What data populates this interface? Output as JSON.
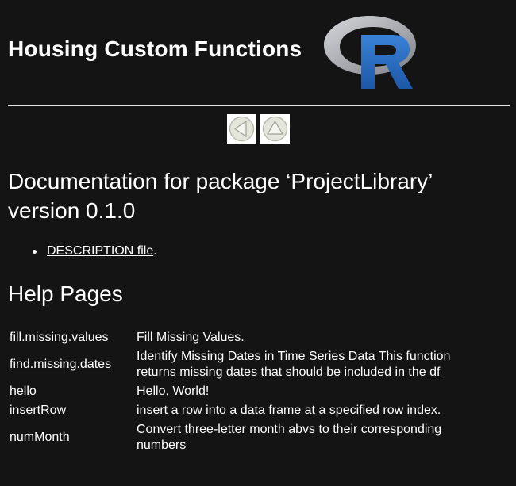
{
  "header": {
    "title": "Housing Custom Functions",
    "logo_icon": "r-logo-icon",
    "logo_colors": {
      "ring": "#a8aab0",
      "letter": "#2466b8"
    }
  },
  "nav": {
    "back_icon": "left-arrow-icon",
    "up_icon": "up-arrow-icon"
  },
  "document": {
    "title": "Documentation for package ‘ProjectLibrary’ version 0.1.0",
    "description_link": "DESCRIPTION file",
    "description_suffix": "."
  },
  "help_pages": {
    "heading": "Help Pages",
    "rows": [
      {
        "name": "fill.missing.values",
        "description": "Fill Missing Values."
      },
      {
        "name": "find.missing.dates",
        "description": "Identify Missing Dates in Time Series Data This function returns missing dates that should be included in the df"
      },
      {
        "name": "hello",
        "description": "Hello, World!"
      },
      {
        "name": "insertRow",
        "description": "insert a row into a data frame at a specified row index."
      },
      {
        "name": "numMonth",
        "description": "Convert three-letter month abvs to their corresponding numbers"
      }
    ]
  }
}
